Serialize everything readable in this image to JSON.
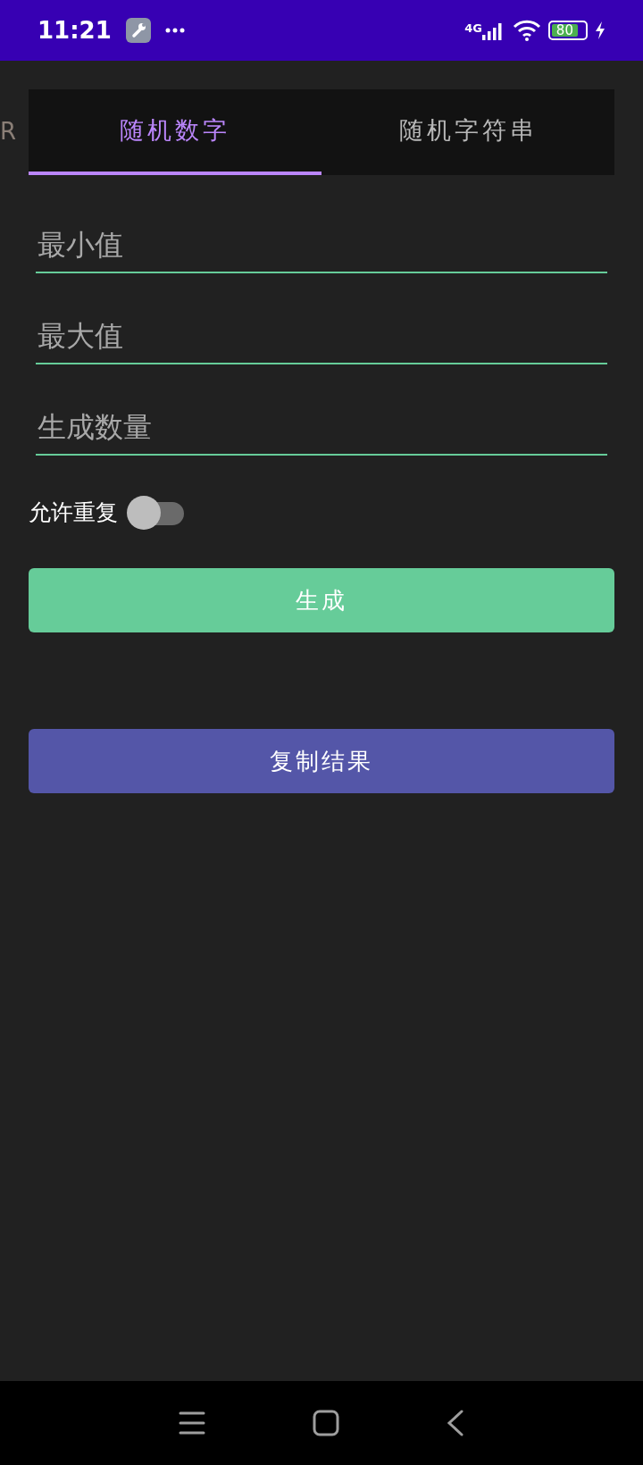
{
  "status_bar": {
    "time": "11:21",
    "network": "4G",
    "battery": "80",
    "charging": true
  },
  "edge_text": "R",
  "tabs": [
    {
      "label": "随机数字",
      "selected": true
    },
    {
      "label": "随机字符串",
      "selected": false
    }
  ],
  "fields": [
    {
      "placeholder": "最小值"
    },
    {
      "placeholder": "最大值"
    },
    {
      "placeholder": "生成数量"
    }
  ],
  "toggle": {
    "label": "允许重复",
    "on": false
  },
  "buttons": [
    {
      "label": "生成",
      "kind": "primary"
    },
    {
      "label": "复制结果",
      "kind": "secondary"
    }
  ]
}
